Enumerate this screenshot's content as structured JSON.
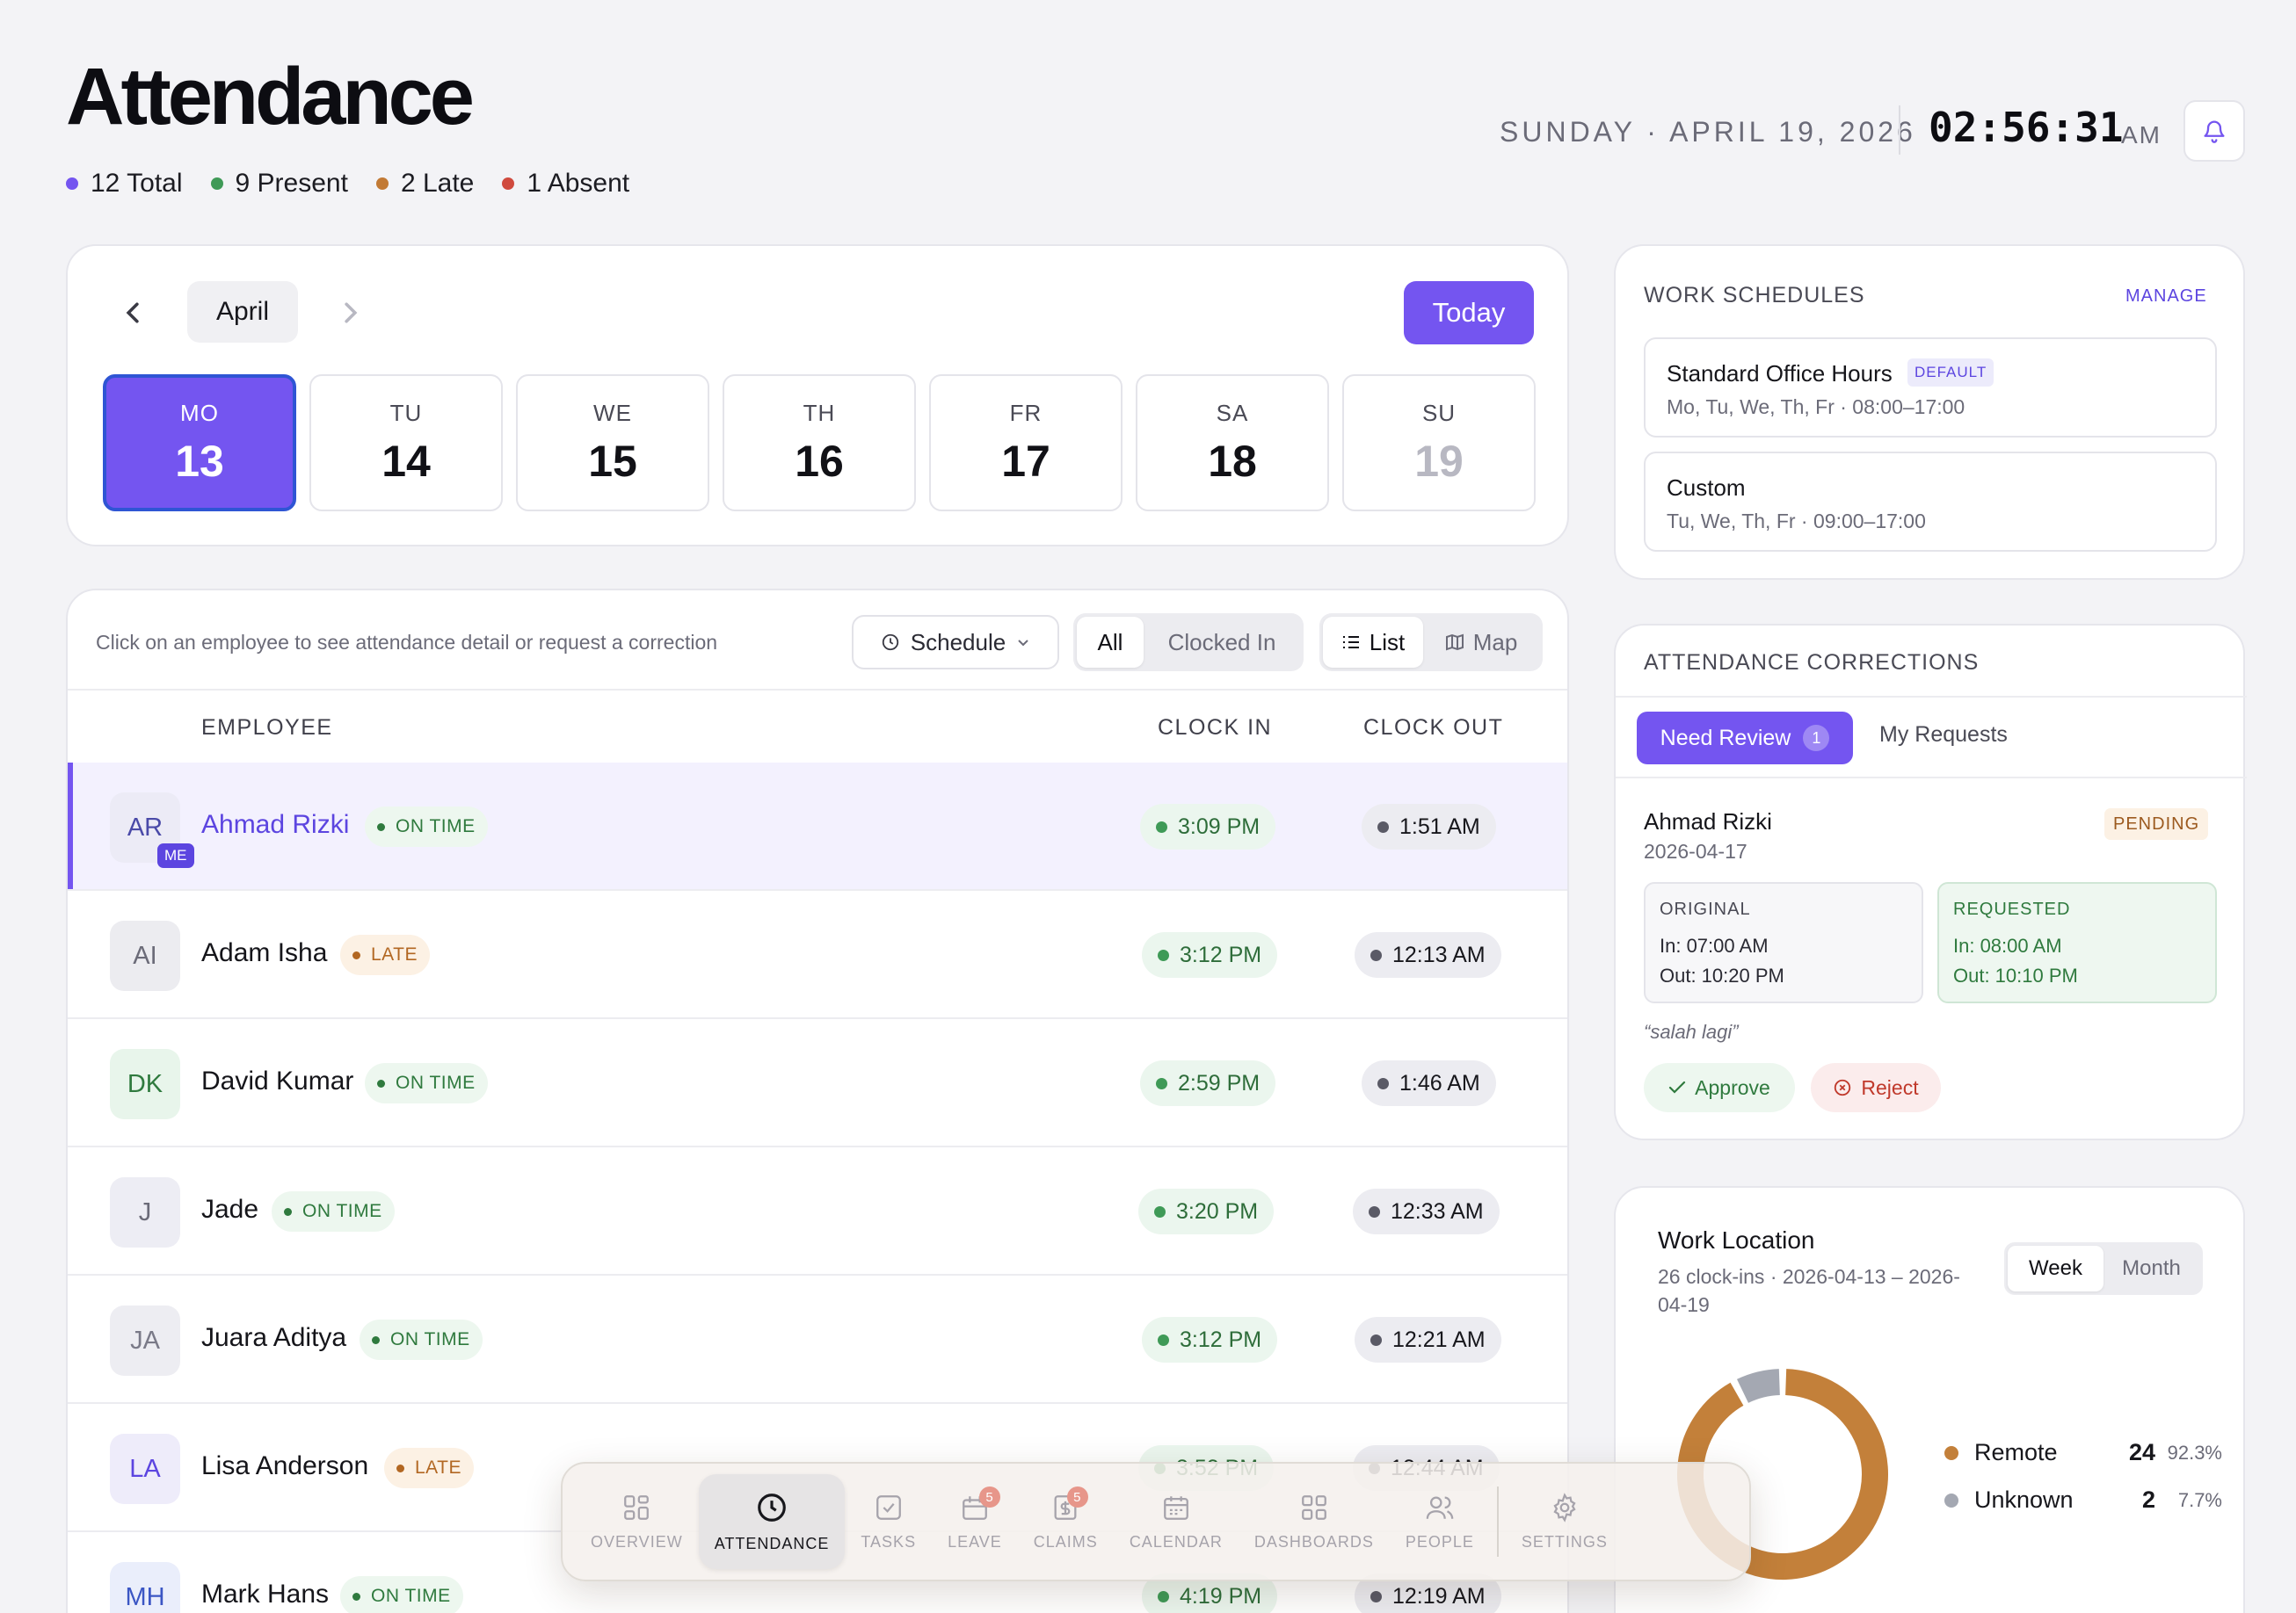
{
  "header": {
    "title": "Attendance",
    "stats": [
      {
        "label": "12 Total",
        "color": "#7455f0"
      },
      {
        "label": "9 Present",
        "color": "#3f9a57"
      },
      {
        "label": "2 Late",
        "color": "#c27a35"
      },
      {
        "label": "1 Absent",
        "color": "#d04a3e"
      }
    ],
    "date": "SUNDAY · APRIL 19, 2026",
    "time": "02:56:31",
    "ampm": "AM",
    "bell_icon": "bell-icon"
  },
  "calendar": {
    "month": "April",
    "today_label": "Today",
    "days": [
      {
        "dow": "MO",
        "num": "13",
        "state": "selected"
      },
      {
        "dow": "TU",
        "num": "14",
        "state": "normal"
      },
      {
        "dow": "WE",
        "num": "15",
        "state": "normal"
      },
      {
        "dow": "TH",
        "num": "16",
        "state": "normal"
      },
      {
        "dow": "FR",
        "num": "17",
        "state": "normal"
      },
      {
        "dow": "SA",
        "num": "18",
        "state": "normal"
      },
      {
        "dow": "SU",
        "num": "19",
        "state": "muted"
      }
    ]
  },
  "employees": {
    "hint": "Click on an employee to see attendance detail or request a correction",
    "schedule_label": "Schedule",
    "filter": {
      "all": "All",
      "clocked_in": "Clocked In"
    },
    "view": {
      "list": "List",
      "map": "Map"
    },
    "columns": {
      "employee": "EMPLOYEE",
      "clock_in": "CLOCK IN",
      "clock_out": "CLOCK OUT"
    },
    "rows": [
      {
        "initials": "AR",
        "name": "Ahmad Rizki",
        "status": "ON TIME",
        "status_type": "ontime",
        "clock_in": "3:09 PM",
        "clock_out": "1:51 AM",
        "me": true,
        "me_label": "ME",
        "avatar_bg": "#ecebf6",
        "avatar_fg": "#4a4aa8"
      },
      {
        "initials": "AI",
        "name": "Adam Isha",
        "status": "LATE",
        "status_type": "late",
        "clock_in": "3:12 PM",
        "clock_out": "12:13 AM",
        "me": false,
        "avatar_bg": "#ececf0",
        "avatar_fg": "#6b6b78"
      },
      {
        "initials": "DK",
        "name": "David Kumar",
        "status": "ON TIME",
        "status_type": "ontime",
        "clock_in": "2:59 PM",
        "clock_out": "1:46 AM",
        "me": false,
        "avatar_bg": "#e8f5eb",
        "avatar_fg": "#2f7a3e"
      },
      {
        "initials": "J",
        "name": "Jade",
        "status": "ON TIME",
        "status_type": "ontime",
        "clock_in": "3:20 PM",
        "clock_out": "12:33 AM",
        "me": false,
        "avatar_bg": "#ededf4",
        "avatar_fg": "#6b6b78"
      },
      {
        "initials": "JA",
        "name": "Juara Aditya",
        "status": "ON TIME",
        "status_type": "ontime",
        "clock_in": "3:12 PM",
        "clock_out": "12:21 AM",
        "me": false,
        "avatar_bg": "#ededf2",
        "avatar_fg": "#7a7a88"
      },
      {
        "initials": "LA",
        "name": "Lisa Anderson",
        "status": "LATE",
        "status_type": "late",
        "clock_in": "3:52 PM",
        "clock_out": "12:44 AM",
        "me": false,
        "avatar_bg": "#eeecfa",
        "avatar_fg": "#5c45e0"
      },
      {
        "initials": "MH",
        "name": "Mark Hans",
        "status": "ON TIME",
        "status_type": "ontime",
        "clock_in": "4:19 PM",
        "clock_out": "12:19 AM",
        "me": false,
        "avatar_bg": "#eaeefb",
        "avatar_fg": "#3b56c4"
      }
    ]
  },
  "work_schedules": {
    "title": "WORK SCHEDULES",
    "manage_label": "MANAGE",
    "items": [
      {
        "name": "Standard Office Hours",
        "tag": "DEFAULT",
        "detail": "Mo, Tu, We, Th, Fr · 08:00–17:00"
      },
      {
        "name": "Custom",
        "tag": "",
        "detail": "Tu, We, Th, Fr · 09:00–17:00"
      }
    ]
  },
  "corrections": {
    "title": "ATTENDANCE CORRECTIONS",
    "tab_need_review": "Need Review",
    "tab_count": "1",
    "tab_my_requests": "My Requests",
    "request": {
      "name": "Ahmad Rizki",
      "date": "2026-04-17",
      "status": "PENDING",
      "original": {
        "title": "ORIGINAL",
        "in": "In: 07:00 AM",
        "out": "Out: 10:20 PM"
      },
      "requested": {
        "title": "REQUESTED",
        "in": "In: 08:00 AM",
        "out": "Out: 10:10 PM"
      },
      "note": "“salah lagi”",
      "approve_label": "Approve",
      "reject_label": "Reject"
    }
  },
  "work_location": {
    "title": "Work Location",
    "subtitle_1": "26 clock-ins · 2026-04-13 – 2026-",
    "subtitle_2": "04-19",
    "range": {
      "week": "Week",
      "month": "Month"
    }
  },
  "chart_data": {
    "type": "pie",
    "categories": [
      "Remote",
      "Unknown"
    ],
    "values": [
      24,
      2
    ],
    "percent_labels": [
      "92.3%",
      "7.7%"
    ],
    "colors": [
      "#c3803a",
      "#a4a8b2"
    ],
    "title": "Work Location"
  },
  "bottom_nav": {
    "items": [
      {
        "label": "OVERVIEW",
        "icon": "grid-icon",
        "active": false,
        "badge": ""
      },
      {
        "label": "ATTENDANCE",
        "icon": "clock-icon",
        "active": true,
        "badge": ""
      },
      {
        "label": "TASKS",
        "icon": "checkbox-icon",
        "active": false,
        "badge": ""
      },
      {
        "label": "LEAVE",
        "icon": "briefcase-icon",
        "active": false,
        "badge": "5"
      },
      {
        "label": "CLAIMS",
        "icon": "receipt-icon",
        "active": false,
        "badge": "5"
      },
      {
        "label": "CALENDAR",
        "icon": "calendar-icon",
        "active": false,
        "badge": ""
      },
      {
        "label": "DASHBOARDS",
        "icon": "dashboard-icon",
        "active": false,
        "badge": ""
      },
      {
        "label": "PEOPLE",
        "icon": "people-icon",
        "active": false,
        "badge": ""
      },
      {
        "label": "SETTINGS",
        "icon": "gear-icon",
        "active": false,
        "badge": ""
      }
    ]
  }
}
